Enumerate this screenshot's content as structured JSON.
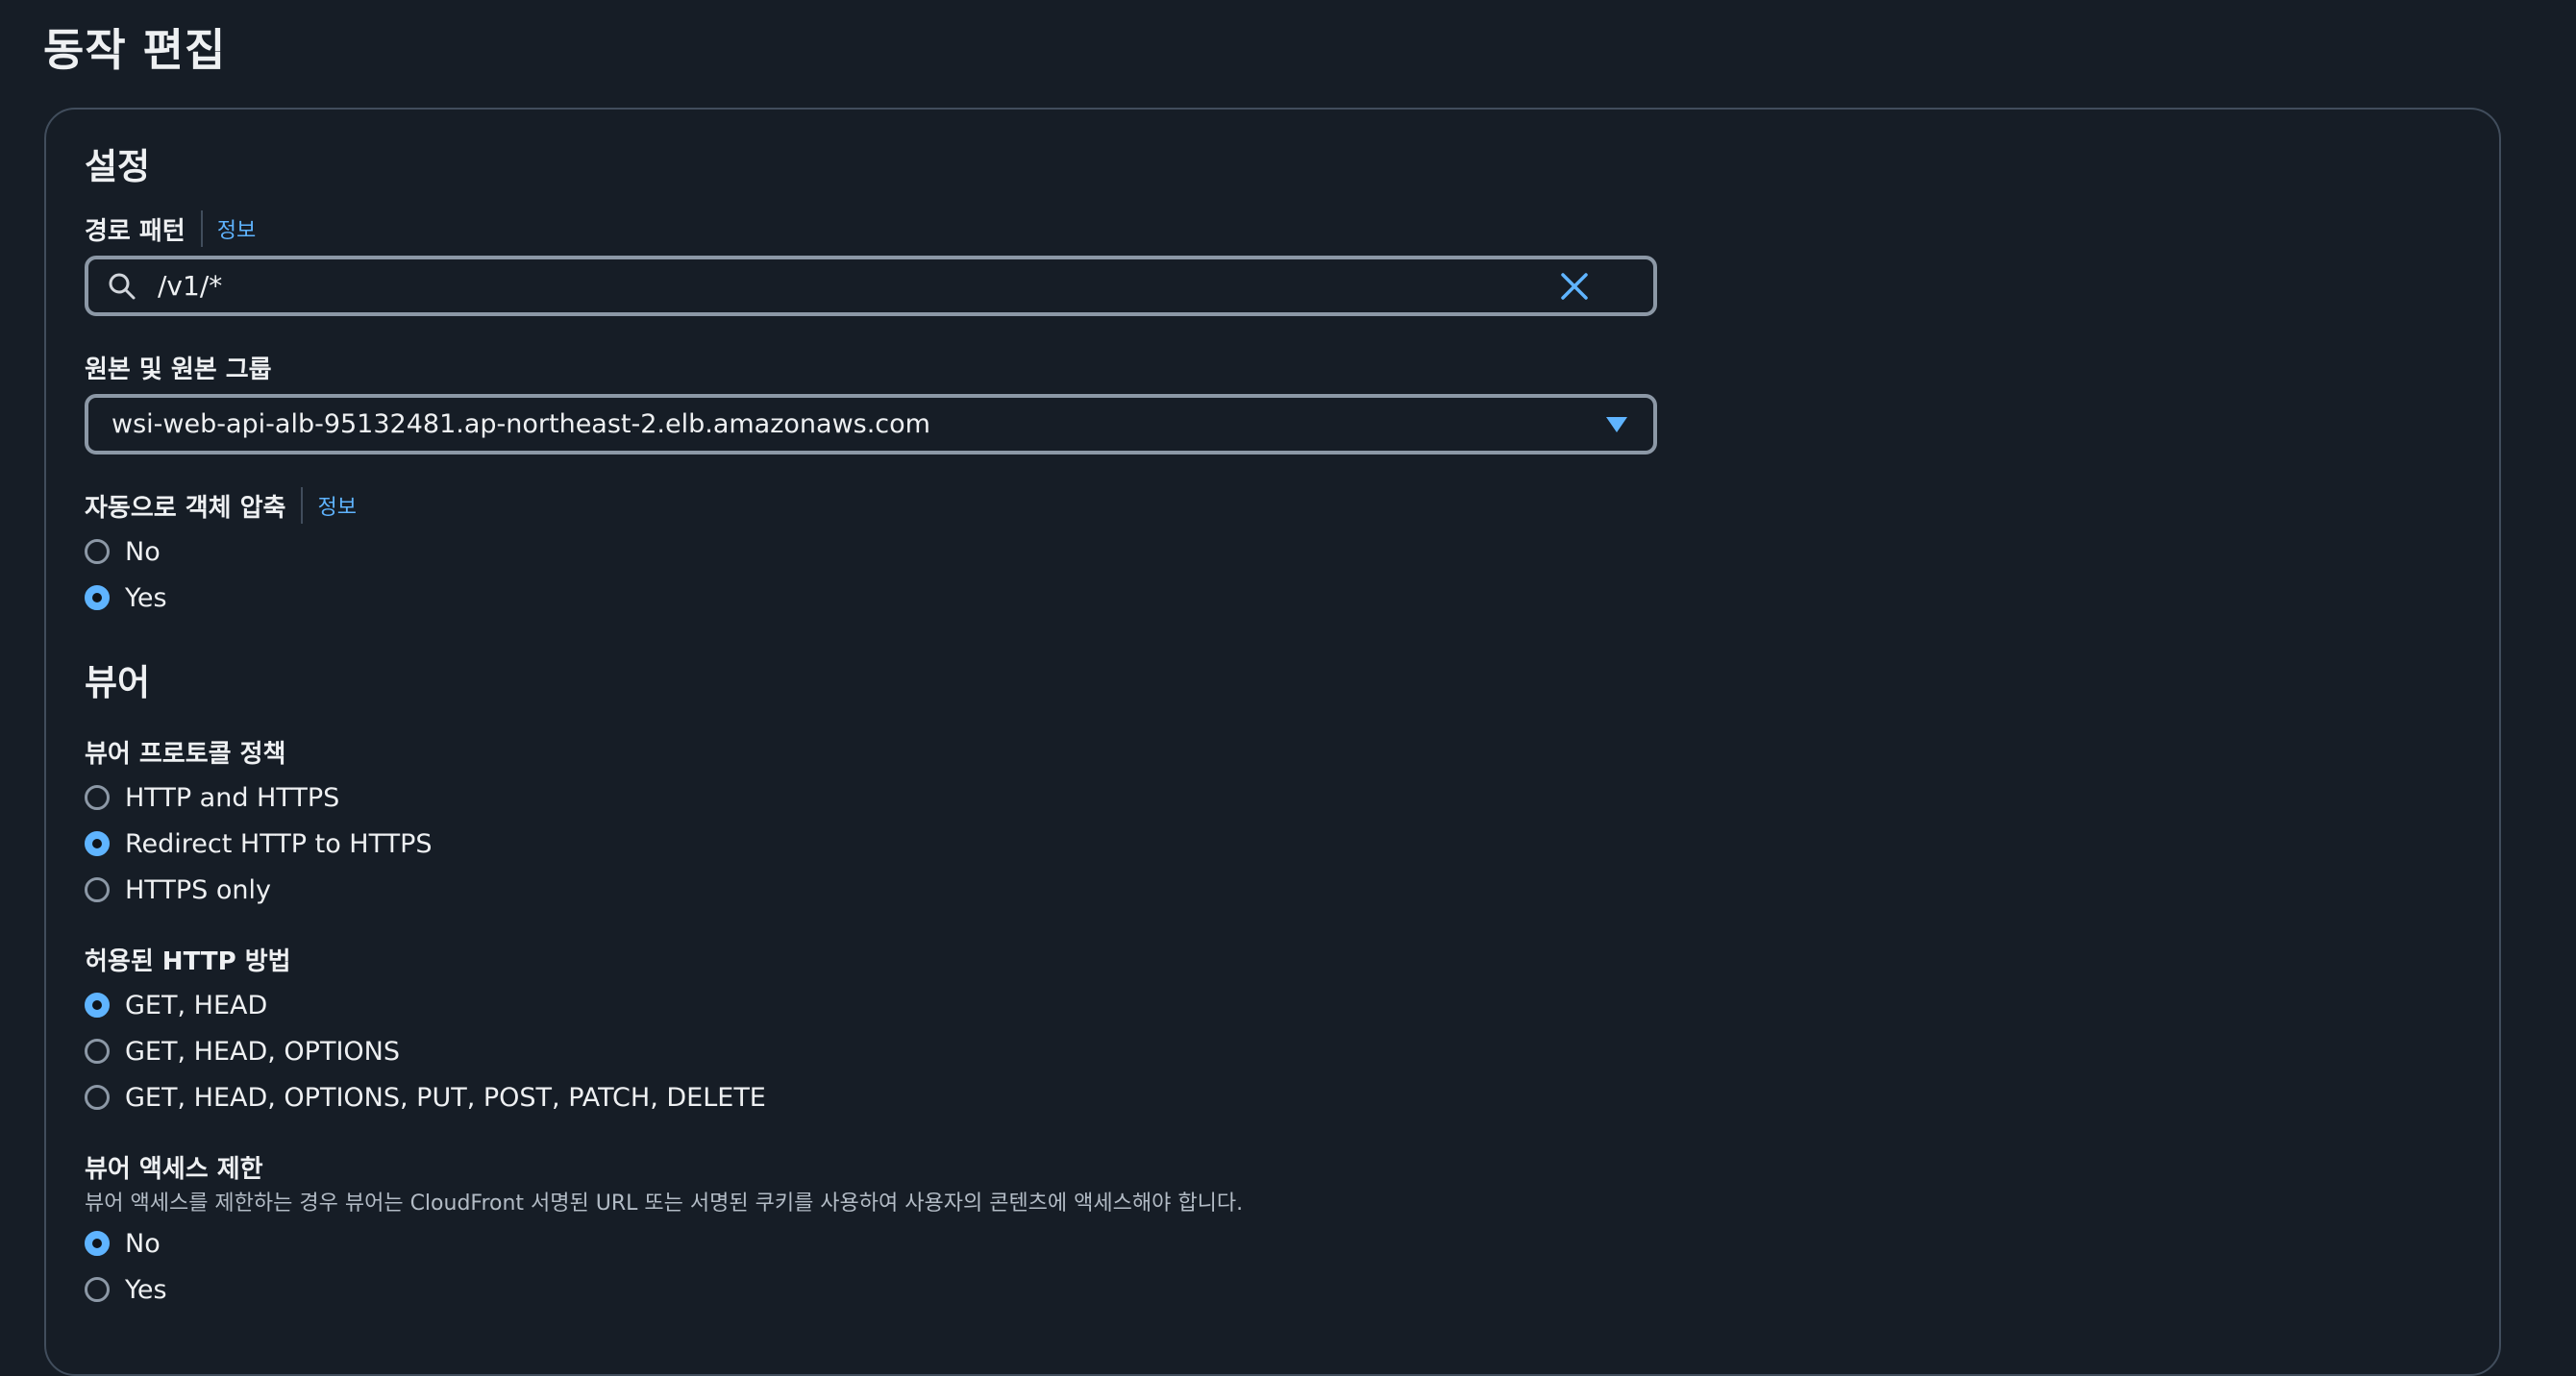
{
  "page": {
    "title": "동작 편집"
  },
  "settings": {
    "title": "설정",
    "path_pattern": {
      "label": "경로 패턴",
      "info": "정보",
      "value": "/v1/*"
    },
    "origin": {
      "label": "원본 및 원본 그룹",
      "selected": "wsi-web-api-alb-95132481.ap-northeast-2.elb.amazonaws.com"
    },
    "compress": {
      "label": "자동으로 객체 압축",
      "info": "정보",
      "options": [
        {
          "label": "No",
          "checked": false
        },
        {
          "label": "Yes",
          "checked": true
        }
      ]
    }
  },
  "viewer": {
    "title": "뷰어",
    "protocol_policy": {
      "label": "뷰어 프로토콜 정책",
      "options": [
        {
          "label": "HTTP and HTTPS",
          "checked": false
        },
        {
          "label": "Redirect HTTP to HTTPS",
          "checked": true
        },
        {
          "label": "HTTPS only",
          "checked": false
        }
      ]
    },
    "allowed_methods": {
      "label": "허용된 HTTP 방법",
      "options": [
        {
          "label": "GET, HEAD",
          "checked": true
        },
        {
          "label": "GET, HEAD, OPTIONS",
          "checked": false
        },
        {
          "label": "GET, HEAD, OPTIONS, PUT, POST, PATCH, DELETE",
          "checked": false
        }
      ]
    },
    "restrict_access": {
      "label": "뷰어 액세스 제한",
      "description": "뷰어 액세스를 제한하는 경우 뷰어는 CloudFront 서명된 URL 또는 서명된 쿠키를 사용하여 사용자의 콘텐츠에 액세스해야 합니다.",
      "options": [
        {
          "label": "No",
          "checked": true
        },
        {
          "label": "Yes",
          "checked": false
        }
      ]
    }
  },
  "colors": {
    "background": "#161d26",
    "accent": "#5fb4ff",
    "border": "#8c98a6",
    "panel_border": "#414d5c",
    "text": "#eef0f2",
    "secondary_text": "#b3bcc6"
  },
  "icons": {
    "search": "search-icon",
    "clear": "close-icon",
    "dropdown": "caret-down-icon"
  }
}
